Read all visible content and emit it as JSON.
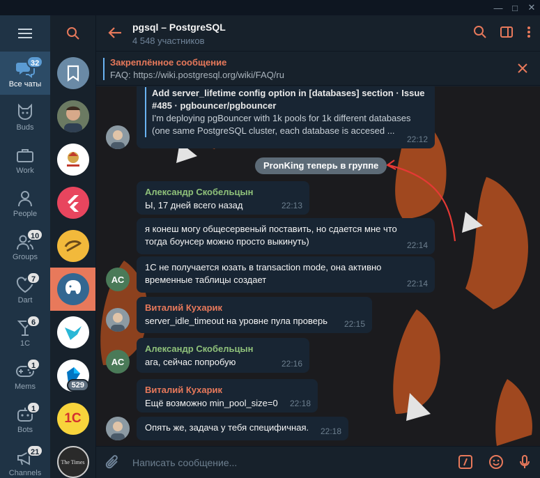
{
  "window": {
    "controls": [
      "minimize",
      "maximize",
      "close"
    ]
  },
  "folders": [
    {
      "label": "Все чаты",
      "badge": "32",
      "icon": "chats-icon",
      "active": true
    },
    {
      "label": "Buds",
      "badge": "",
      "icon": "cat-icon"
    },
    {
      "label": "Work",
      "badge": "",
      "icon": "briefcase-icon"
    },
    {
      "label": "People",
      "badge": "",
      "icon": "person-icon"
    },
    {
      "label": "Groups",
      "badge": "10",
      "icon": "group-icon"
    },
    {
      "label": "Dart",
      "badge": "7",
      "icon": "heart-icon"
    },
    {
      "label": "1C",
      "badge": "6",
      "icon": "cocktail-icon"
    },
    {
      "label": "Mems",
      "badge": "1",
      "icon": "gamepad-icon"
    },
    {
      "label": "Bots",
      "badge": "1",
      "icon": "bot-icon"
    },
    {
      "label": "Channels",
      "badge": "21",
      "icon": "megaphone-icon"
    }
  ],
  "chatlist": {
    "items": [
      {
        "name": "saved-messages",
        "badge": ""
      },
      {
        "name": "chat-person",
        "badge": ""
      },
      {
        "name": "chat-emblem",
        "badge": ""
      },
      {
        "name": "chat-flutter",
        "badge": ""
      },
      {
        "name": "chat-gopher",
        "badge": ""
      },
      {
        "name": "chat-postgresql",
        "badge": "",
        "active": true
      },
      {
        "name": "chat-bird",
        "badge": ""
      },
      {
        "name": "chat-dart",
        "badge": "529"
      },
      {
        "name": "chat-1c",
        "badge": ""
      },
      {
        "name": "chat-times",
        "badge": ""
      }
    ],
    "logo_text": {
      "onec": "1С",
      "times": "The Times"
    }
  },
  "header": {
    "title": "pgsql – PostgreSQL",
    "subtitle": "4 548 участников"
  },
  "pinned": {
    "title": "Закреплённое сообщение",
    "text": "FAQ: https://wiki.postgresql.org/wiki/FAQ/ru"
  },
  "messages": {
    "link_preview": {
      "title_line1": "Add server_lifetime config option in [databases] section · Issue",
      "title_line2": "#485 · pgbouncer/pgbouncer",
      "desc_line1": "I'm deploying pgBouncer with 1k pools for 1k different databases",
      "desc_line2": "(one same PostgreSQL cluster, each database is accesed ...",
      "time": "22:12"
    },
    "service": "PronKing теперь в группе",
    "ac_initials": "АС",
    "m1": {
      "author": "Александр Скобельцын",
      "text": "Ы, 17 дней всего назад",
      "time": "22:13"
    },
    "m2": {
      "line1": "я конеш могу общесервеный поставить, но сдается мне что",
      "line2": "тогда боунсер можно просто выкинуть)",
      "time": "22:14"
    },
    "m3": {
      "line1": "1С не получается юзать в transaction mode, она активно",
      "line2": "временные таблицы создает",
      "time": "22:14"
    },
    "m4": {
      "author": "Виталий Кухарик",
      "text": "server_idle_timeout на уровне пула проверь",
      "time": "22:15"
    },
    "m5": {
      "author": "Александр Скобельцын",
      "text": "ага, сейчас попробую",
      "time": "22:16"
    },
    "m6": {
      "author": "Виталий Кухарик",
      "text": "Ещё возможно min_pool_size=0",
      "time": "22:18"
    },
    "m7": {
      "text": "Опять же, задача у тебя специфичная.",
      "time": "22:18"
    }
  },
  "compose": {
    "placeholder": "Написать сообщение..."
  },
  "colors": {
    "accent": "#e8795b",
    "link": "#6ab3f3",
    "bubble": "#182533",
    "name_green": "#8fc17a",
    "name_orange": "#e8795b"
  }
}
